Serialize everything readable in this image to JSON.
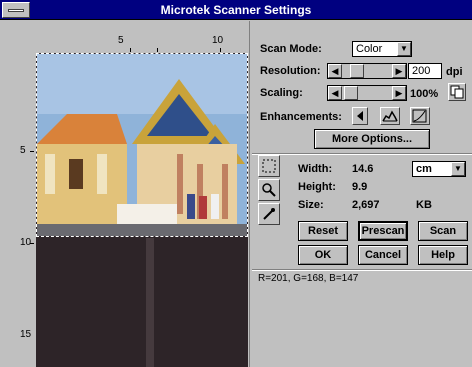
{
  "window": {
    "title": "Microtek Scanner Settings"
  },
  "rulers": {
    "horizontal": [
      "5",
      "10"
    ],
    "vertical": [
      "5",
      "10",
      "15"
    ]
  },
  "scan_mode": {
    "label": "Scan Mode:",
    "value": "Color"
  },
  "resolution": {
    "label": "Resolution:",
    "value": "200",
    "unit": "dpi"
  },
  "scaling": {
    "label": "Scaling:",
    "value": "100%"
  },
  "enhancements": {
    "label": "Enhancements:"
  },
  "more_options": "More Options...",
  "info": {
    "width_label": "Width:",
    "width_value": "14.6",
    "height_label": "Height:",
    "height_value": "9.9",
    "size_label": "Size:",
    "size_value": "2,697",
    "size_unit": "KB",
    "unit_select": "cm"
  },
  "buttons": {
    "reset": "Reset",
    "prescan": "Prescan",
    "scan": "Scan",
    "ok": "OK",
    "cancel": "Cancel",
    "help": "Help"
  },
  "status": "R=201, G=168, B=147"
}
